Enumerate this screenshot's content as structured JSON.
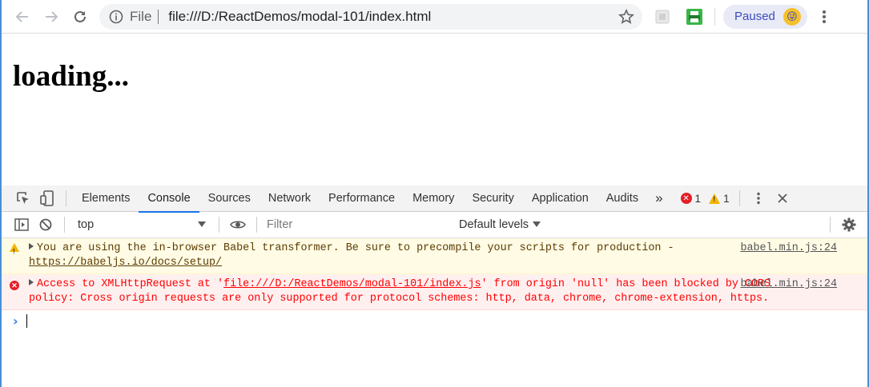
{
  "browser": {
    "url_scheme_label": "File",
    "url": "file:///D:/ReactDemos/modal-101/index.html",
    "sync_status": "Paused"
  },
  "page": {
    "heading": "loading..."
  },
  "devtools": {
    "tabs": [
      "Elements",
      "Console",
      "Sources",
      "Network",
      "Performance",
      "Memory",
      "Security",
      "Application",
      "Audits"
    ],
    "more_tabs": "»",
    "error_count": "1",
    "warning_count": "1",
    "context": "top",
    "filter_placeholder": "Filter",
    "levels_label": "Default levels",
    "messages": {
      "warning": {
        "text_before": "You are using the in-browser Babel transformer. Be sure to precompile your scripts for production - ",
        "link": "https://babeljs.io/docs/setup/",
        "source": "babel.min.js:24"
      },
      "error": {
        "text_before": "Access to XMLHttpRequest at '",
        "link": "file:///D:/ReactDemos/modal-101/index.js",
        "text_after": "' from origin 'null' has been blocked by CORS policy: Cross origin requests are only supported for protocol schemes: http, data, chrome, chrome-extension, https.",
        "source": "babel.min.js:24"
      }
    }
  },
  "colors": {
    "accent": "#1a73e8",
    "error": "#ff0000",
    "warning_bg": "#fffbe5",
    "error_bg": "#fff0f0"
  }
}
